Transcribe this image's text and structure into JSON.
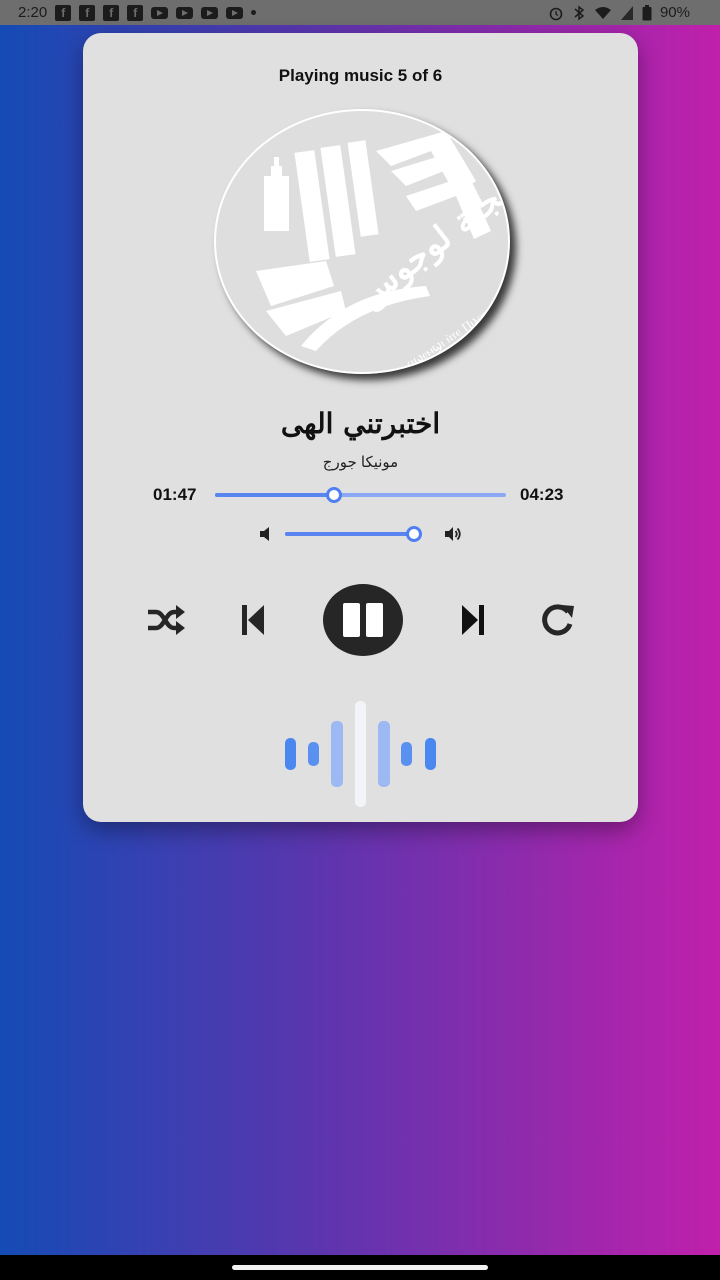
{
  "status_bar": {
    "time": "2:20",
    "battery": "90%",
    "notification_icons": [
      "facebook-icon",
      "facebook-icon",
      "facebook-icon",
      "facebook-icon",
      "youtube-icon",
      "youtube-icon",
      "youtube-icon",
      "youtube-icon",
      "dot-icon"
    ],
    "system_icons": [
      "alarm-icon",
      "bluetooth-icon",
      "wifi-icon",
      "signal-icon",
      "battery-icon"
    ]
  },
  "player": {
    "header": "Playing music 5 of 6",
    "song_title": "اختبرتني الهى",
    "artist": "مونيكا جورج",
    "current_time": "01:47",
    "total_time": "04:23",
    "progress_fraction": 0.41,
    "volume_fraction": 0.95,
    "album_art": {
      "arabic_text": "مجلة لوجوس",
      "coptic_text": "Ⲡⲓⲙⲉⲧⲣⲉϥϣⲉⲙϣⲓ ⲛ̀ⲧⲉ Ⲡⲓⲗⲟⲅⲟⲥ"
    },
    "controls": {
      "shuffle": "shuffle-icon",
      "previous": "skip-previous-icon",
      "play_pause": "pause-icon",
      "next": "skip-next-icon",
      "repeat": "repeat-icon"
    }
  },
  "colors": {
    "gradient_start": "#154bb5",
    "gradient_end": "#c020ab",
    "accent": "#5a84ef",
    "card_background": "#e0e0e0",
    "play_button": "#262626"
  }
}
